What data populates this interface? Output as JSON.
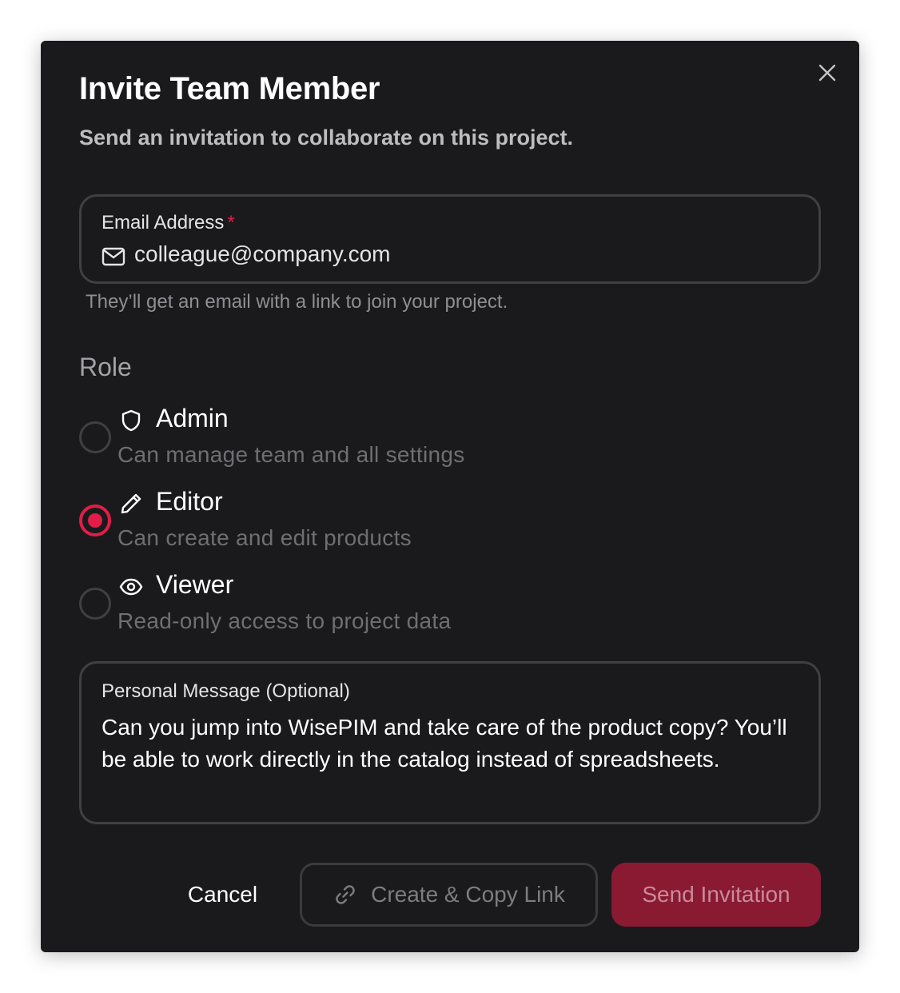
{
  "dialog": {
    "title": "Invite Team Member",
    "subtitle": "Send an invitation to collaborate on this project."
  },
  "email": {
    "label": "Email Address",
    "required_mark": "*",
    "placeholder": "colleague@company.com",
    "value": "",
    "hint": "They’ll get an email with a link to join your project."
  },
  "role": {
    "label": "Role",
    "selected": "editor",
    "options": [
      {
        "name": "Admin",
        "description": "Can manage team and all settings",
        "icon": "shield-icon"
      },
      {
        "name": "Editor",
        "description": "Can create and edit products",
        "icon": "pencil-icon"
      },
      {
        "name": "Viewer",
        "description": "Read-only access to project data",
        "icon": "eye-icon"
      }
    ]
  },
  "message": {
    "label": "Personal Message (Optional)",
    "text": "Can you jump into WisePIM and take care of the product copy? You’ll be able to work directly in the catalog instead of spreadsheets."
  },
  "actions": {
    "cancel": "Cancel",
    "copy_link": "Create & Copy Link",
    "send": "Send Invitation"
  },
  "colors": {
    "accent": "#e11d48",
    "send_button_bg": "#8a1a32",
    "dialog_bg": "#1a1a1c"
  }
}
